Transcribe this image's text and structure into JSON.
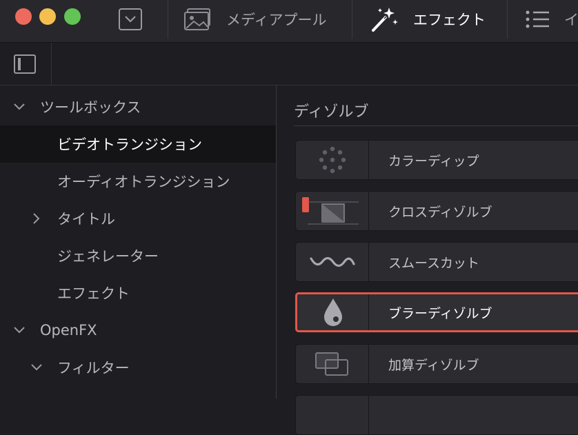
{
  "titlebar": {
    "tabs": [
      {
        "label": "メディアプール",
        "icon": "image-icon"
      },
      {
        "label": "エフェクト",
        "icon": "magic-wand-icon",
        "active": true
      },
      {
        "label": "イ",
        "icon": "list-icon"
      }
    ]
  },
  "sidebar": {
    "items": [
      {
        "label": "ツールボックス",
        "level": 0,
        "expanded": true
      },
      {
        "label": "ビデオトランジション",
        "level": 1,
        "selected": true
      },
      {
        "label": "オーディオトランジション",
        "level": 1
      },
      {
        "label": "タイトル",
        "level": 1,
        "collapsed": true
      },
      {
        "label": "ジェネレーター",
        "level": 1
      },
      {
        "label": "エフェクト",
        "level": 1
      },
      {
        "label": "OpenFX",
        "level": 0,
        "expanded": true
      },
      {
        "label": "フィルター",
        "level": 1,
        "expanded": true
      }
    ]
  },
  "main": {
    "section_title": "ディゾルブ",
    "effects": [
      {
        "label": "カラーディップ",
        "icon": "dots-circle-icon"
      },
      {
        "label": "クロスディゾルブ",
        "icon": "cross-dissolve-icon"
      },
      {
        "label": "スムースカット",
        "icon": "wave-icon"
      },
      {
        "label": "ブラーディゾルブ",
        "icon": "drop-icon",
        "selected": true
      },
      {
        "label": "加算ディゾルブ",
        "icon": "overlap-squares-icon"
      }
    ]
  },
  "colors": {
    "accent": "#e4574a",
    "background": "#1e1e22",
    "titlebar": "#28282c"
  }
}
